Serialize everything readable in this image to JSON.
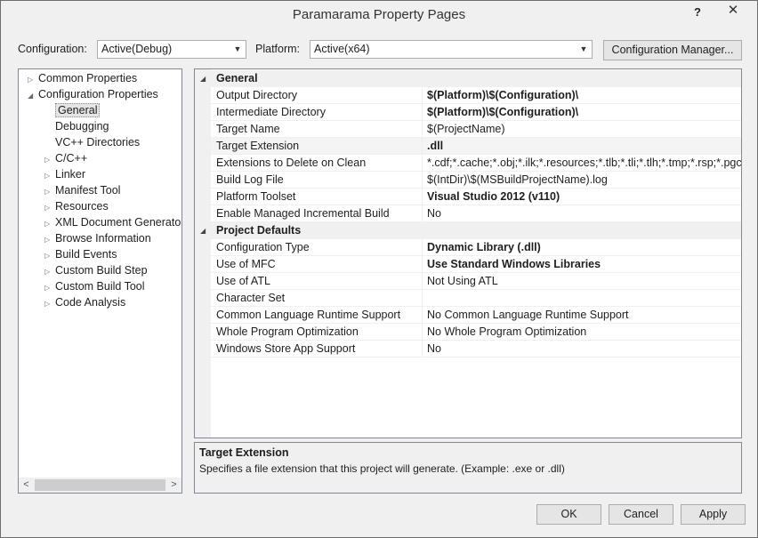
{
  "window": {
    "title": "Paramarama Property Pages",
    "help_glyph": "?",
    "close_glyph": "✕"
  },
  "toolbar": {
    "configuration_label": "Configuration:",
    "configuration_value": "Active(Debug)",
    "platform_label": "Platform:",
    "platform_value": "Active(x64)",
    "config_manager_label": "Configuration Manager..."
  },
  "tree": {
    "items": [
      {
        "label": "Common Properties",
        "expander": "▷"
      },
      {
        "label": "Configuration Properties",
        "expander": "◢"
      },
      {
        "label": "General",
        "expander": ""
      },
      {
        "label": "Debugging",
        "expander": ""
      },
      {
        "label": "VC++ Directories",
        "expander": ""
      },
      {
        "label": "C/C++",
        "expander": "▷"
      },
      {
        "label": "Linker",
        "expander": "▷"
      },
      {
        "label": "Manifest Tool",
        "expander": "▷"
      },
      {
        "label": "Resources",
        "expander": "▷"
      },
      {
        "label": "XML Document Generator",
        "expander": "▷"
      },
      {
        "label": "Browse Information",
        "expander": "▷"
      },
      {
        "label": "Build Events",
        "expander": "▷"
      },
      {
        "label": "Custom Build Step",
        "expander": "▷"
      },
      {
        "label": "Custom Build Tool",
        "expander": "▷"
      },
      {
        "label": "Code Analysis",
        "expander": "▷"
      }
    ],
    "scroll_left": "<",
    "scroll_right": ">"
  },
  "grid": {
    "categories": [
      {
        "label": "General",
        "expander": "◢"
      },
      {
        "label": "Project Defaults",
        "expander": "◢"
      }
    ],
    "general_rows": [
      {
        "name": "Output Directory",
        "value": "$(Platform)\\$(Configuration)\\"
      },
      {
        "name": "Intermediate Directory",
        "value": "$(Platform)\\$(Configuration)\\"
      },
      {
        "name": "Target Name",
        "value": "$(ProjectName)"
      },
      {
        "name": "Target Extension",
        "value": ".dll"
      },
      {
        "name": "Extensions to Delete on Clean",
        "value": "*.cdf;*.cache;*.obj;*.ilk;*.resources;*.tlb;*.tli;*.tlh;*.tmp;*.rsp;*.pgc;*.p"
      },
      {
        "name": "Build Log File",
        "value": "$(IntDir)\\$(MSBuildProjectName).log"
      },
      {
        "name": "Platform Toolset",
        "value": "Visual Studio 2012 (v110)"
      },
      {
        "name": "Enable Managed Incremental Build",
        "value": "No"
      }
    ],
    "defaults_rows": [
      {
        "name": "Configuration Type",
        "value": "Dynamic Library (.dll)"
      },
      {
        "name": "Use of MFC",
        "value": "Use Standard Windows Libraries"
      },
      {
        "name": "Use of ATL",
        "value": "Not Using ATL"
      },
      {
        "name": "Character Set",
        "value": ""
      },
      {
        "name": "Common Language Runtime Support",
        "value": "No Common Language Runtime Support"
      },
      {
        "name": "Whole Program Optimization",
        "value": "No Whole Program Optimization"
      },
      {
        "name": "Windows Store App Support",
        "value": "No"
      }
    ]
  },
  "description": {
    "title": "Target Extension",
    "text": "Specifies a file extension that this project will generate. (Example: .exe or .dll)"
  },
  "buttons": {
    "ok": "OK",
    "cancel": "Cancel",
    "apply": "Apply"
  },
  "colors": {
    "window_bg": "#f0f0f0",
    "panel_bg": "#ffffff",
    "border": "#828790",
    "selection": "#e5e5e5"
  }
}
